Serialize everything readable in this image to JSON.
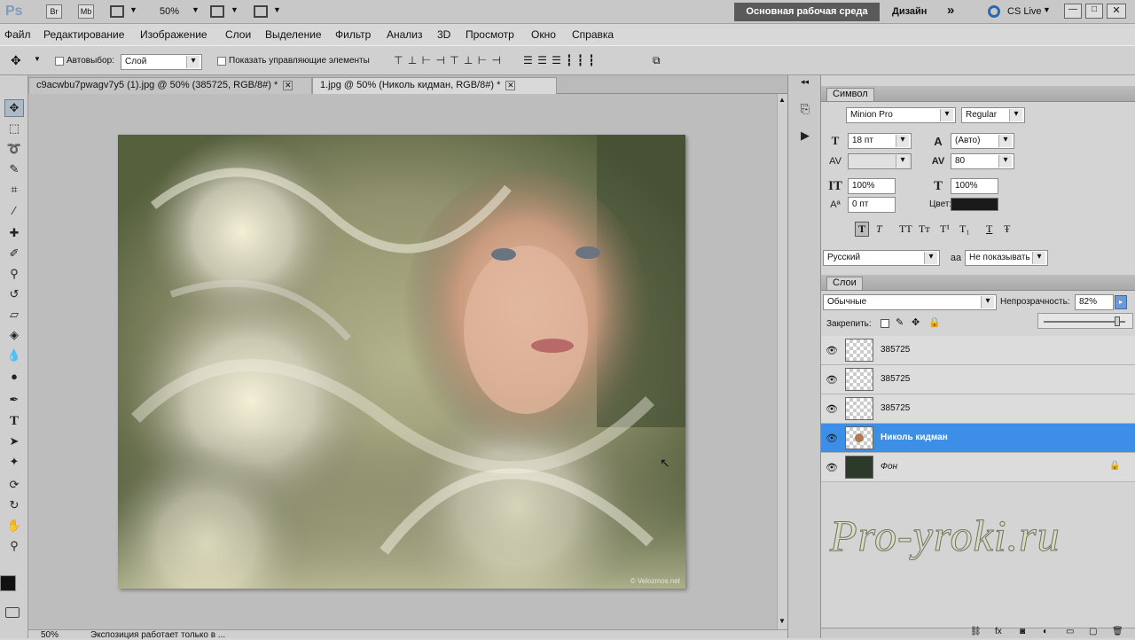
{
  "app": {
    "logo": "Ps",
    "bridge": "Br",
    "mini_bridge": "Mb",
    "zoom": "50%",
    "workspace_active": "Основная рабочая среда",
    "workspace_design": "Дизайн",
    "cs_live": "CS Live"
  },
  "menu": [
    "Файл",
    "Редактирование",
    "Изображение",
    "Слои",
    "Выделение",
    "Фильтр",
    "Анализ",
    "3D",
    "Просмотр",
    "Окно",
    "Справка"
  ],
  "options": {
    "autoselect_label": "Автовыбор:",
    "autoselect_value": "Слой",
    "show_controls": "Показать управляющие элементы"
  },
  "tabs": [
    {
      "label": "c9acwbu7pwagv7y5 (1).jpg @ 50% (385725, RGB/8#) *"
    },
    {
      "label": "1.jpg @ 50% (Николь кидман, RGB/8#) *"
    }
  ],
  "status": {
    "zoom": "50%",
    "message": "Экспозиция работает только в ..."
  },
  "canvas": {
    "watermark": "© Velozmos.net"
  },
  "character": {
    "title": "Символ",
    "font_family": "Minion Pro",
    "font_style": "Regular",
    "size": "18 пт",
    "leading": "(Авто)",
    "kerning": "",
    "tracking": "80",
    "vscale": "100%",
    "hscale": "100%",
    "baseline": "0 пт",
    "color_label": "Цвет:",
    "language": "Русский",
    "antialias": "Не показывать",
    "style_buttons": [
      "T",
      "T",
      "TT",
      "Tт",
      "T¹",
      "T₁",
      "T",
      "Ŧ"
    ]
  },
  "layers": {
    "title": "Слои",
    "blend": "Обычные",
    "opacity_label": "Непрозрачность:",
    "opacity": "82%",
    "lock_label": "Закрепить:",
    "items": [
      {
        "name": "385725",
        "selected": false
      },
      {
        "name": "385725",
        "selected": false
      },
      {
        "name": "385725",
        "selected": false
      },
      {
        "name": "Николь кидман",
        "selected": true
      },
      {
        "name": "Фон",
        "selected": false
      }
    ]
  },
  "brand": "Pro-yroki.ru",
  "colors": {
    "selection": "#3d8ee6",
    "workspace_active_bg": "#5a5a5a"
  }
}
